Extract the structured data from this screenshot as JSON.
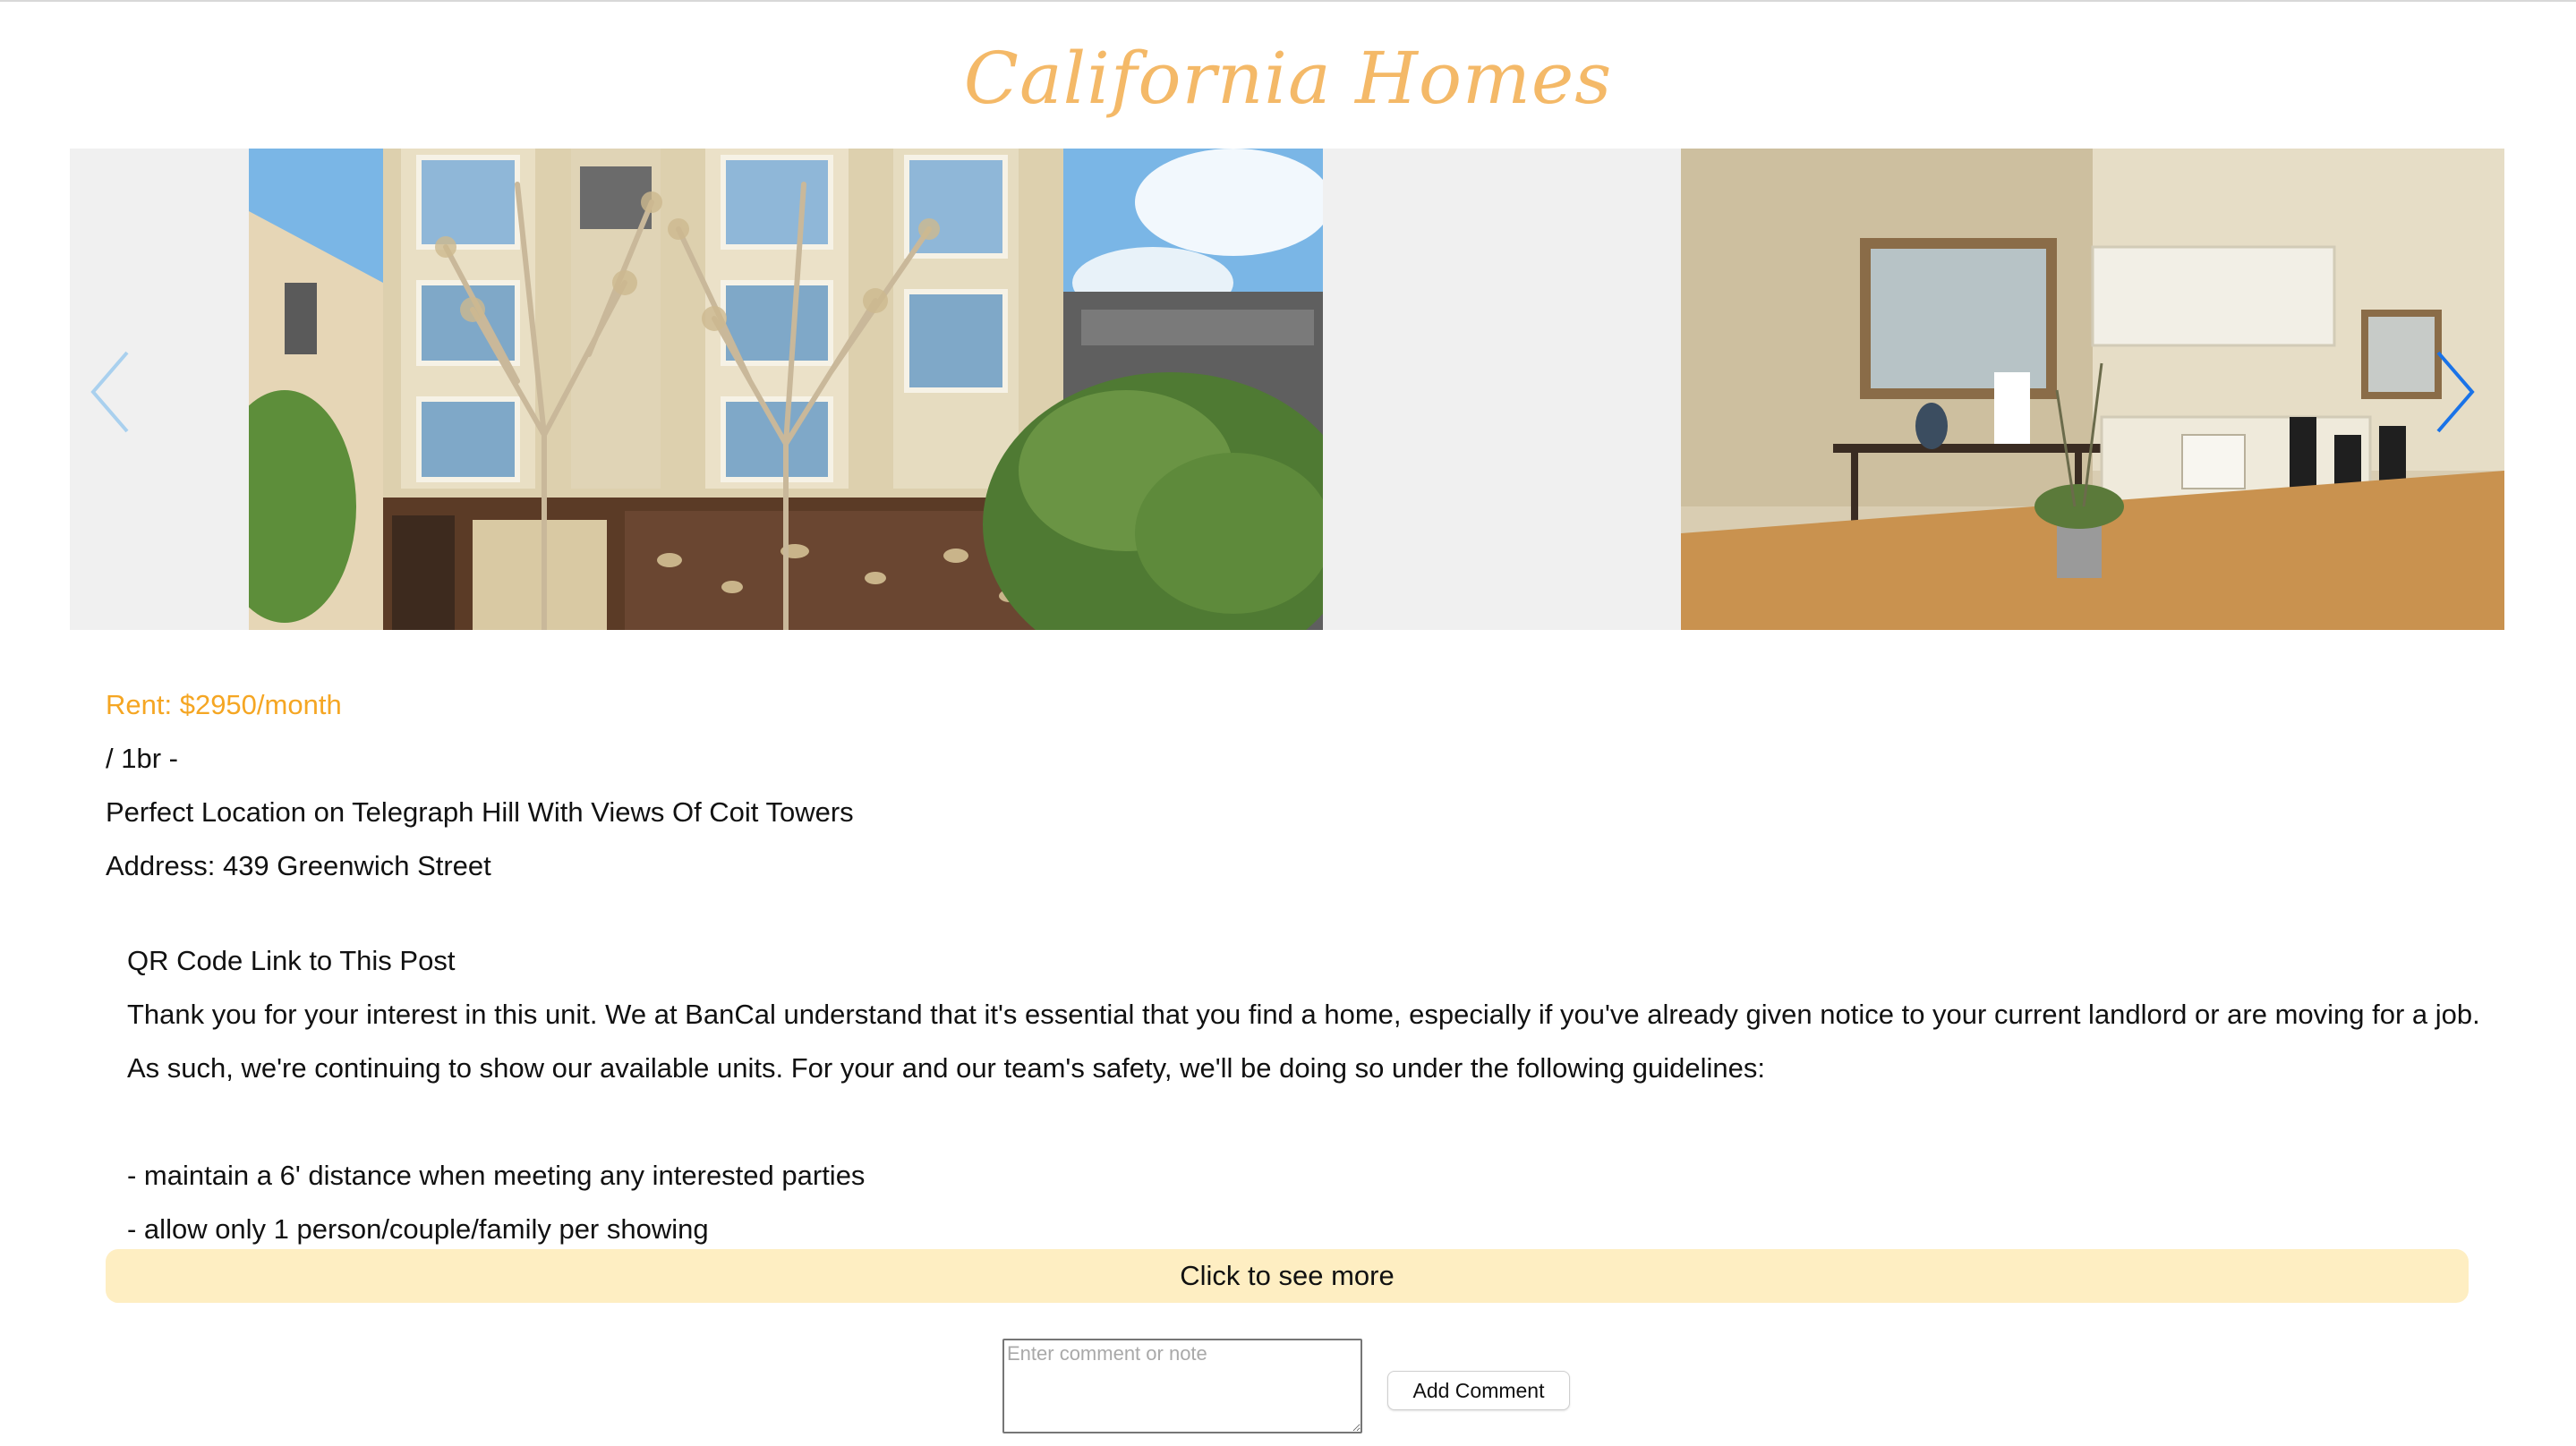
{
  "site": {
    "title": "California Homes"
  },
  "carousel": {
    "slides": [
      {
        "alt": ""
      },
      {
        "alt": ""
      }
    ],
    "prev_icon": "chevron-left-icon",
    "next_icon": "chevron-right-icon",
    "prev_color": "#a9d0ee",
    "next_color": "#1a73e8"
  },
  "listing": {
    "rent": "Rent: $2950/month",
    "bedrooms": "/ 1br -",
    "headline": "Perfect Location on Telegraph Hill With Views Of Coit Towers",
    "address": "Address: 439 Greenwich Street"
  },
  "description": {
    "qr_line": "QR Code Link to This Post",
    "intro": "Thank you for your interest in this unit. We at BanCal understand that it's essential that you find a home, especially if you've already given notice to your current landlord or are moving for a job. As such, we're continuing to show our available units. For your and our team's safety, we'll be doing so under the following guidelines:",
    "guideline_1": "- maintain a 6' distance when meeting any interested parties",
    "guideline_2": "- allow only 1 person/couple/family per showing"
  },
  "actions": {
    "see_more": "Click to see more",
    "comment_placeholder": "Enter comment or note",
    "add_comment": "Add Comment"
  },
  "colors": {
    "title": "#f4b968",
    "rent": "#f5a623",
    "see_more_bg": "#feeec2",
    "carousel_bg": "#f0f0f0"
  }
}
